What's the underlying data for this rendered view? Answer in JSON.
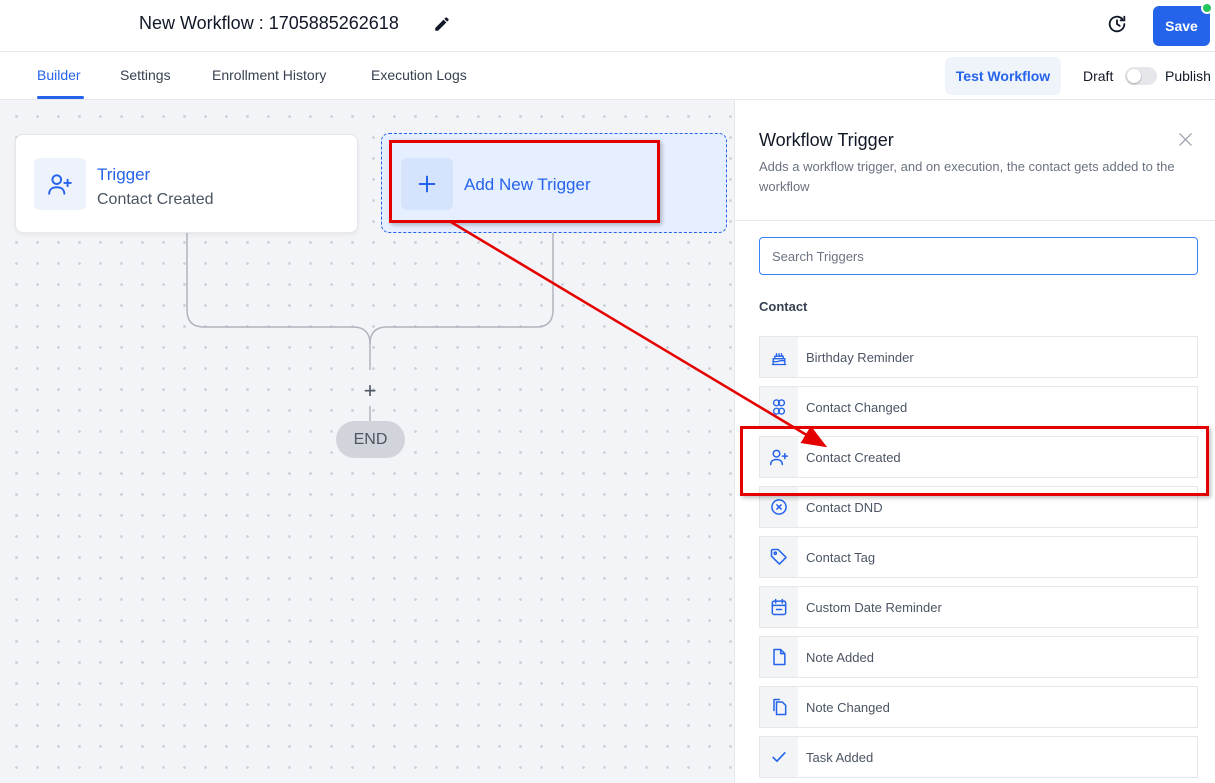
{
  "header": {
    "workflow_title": "New Workflow : 1705885262618",
    "edit_icon": "pencil-icon",
    "history_icon": "clock-history-icon",
    "save_label": "Save",
    "accent_color": "#2563eb"
  },
  "tabs": [
    {
      "label": "Builder",
      "active": true
    },
    {
      "label": "Settings",
      "active": false
    },
    {
      "label": "Enrollment History",
      "active": false
    },
    {
      "label": "Execution Logs",
      "active": false
    }
  ],
  "toolbar": {
    "test_workflow_label": "Test Workflow",
    "draft_label": "Draft",
    "publish_label": "Publish",
    "published": false
  },
  "canvas": {
    "trigger_card": {
      "title": "Trigger",
      "subtitle": "Contact Created",
      "icon": "user-plus-icon"
    },
    "add_trigger": {
      "label": "Add New Trigger",
      "icon": "plus-icon"
    },
    "add_step_symbol": "+",
    "end_label": "END"
  },
  "panel": {
    "title": "Workflow Trigger",
    "description": "Adds a workflow trigger, and on execution, the contact gets added to the workflow",
    "search_placeholder": "Search Triggers",
    "section_label": "Contact",
    "items": [
      {
        "label": "Birthday Reminder",
        "icon": "cake-icon"
      },
      {
        "label": "Contact Changed",
        "icon": "users-icon"
      },
      {
        "label": "Contact Created",
        "icon": "user-plus-icon"
      },
      {
        "label": "Contact DND",
        "icon": "circle-x-icon"
      },
      {
        "label": "Contact Tag",
        "icon": "tag-icon"
      },
      {
        "label": "Custom Date Reminder",
        "icon": "calendar-icon"
      },
      {
        "label": "Note Added",
        "icon": "file-icon"
      },
      {
        "label": "Note Changed",
        "icon": "files-icon"
      },
      {
        "label": "Task Added",
        "icon": "check-icon"
      }
    ]
  },
  "annotations": {
    "highlight_color": "#e50000"
  }
}
